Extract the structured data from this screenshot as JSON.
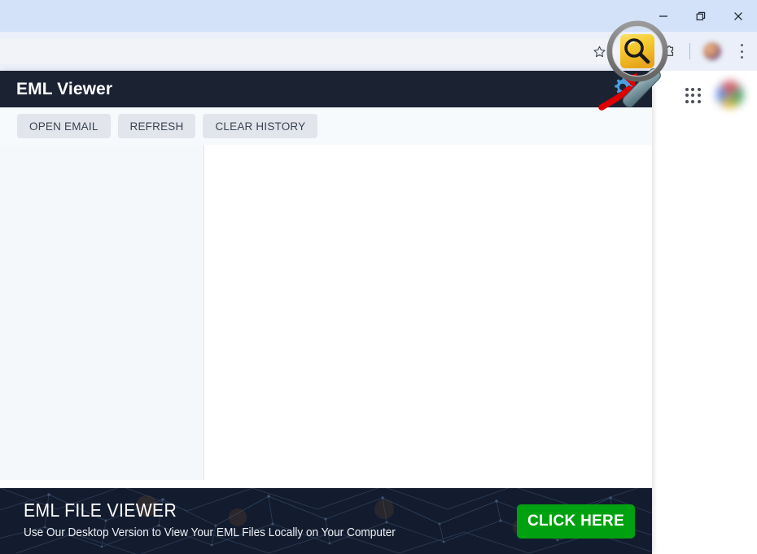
{
  "window": {
    "controls": [
      {
        "name": "minimize",
        "glyph": "minimize-icon"
      },
      {
        "name": "restore",
        "glyph": "restore-icon"
      },
      {
        "name": "close",
        "glyph": "close-icon"
      }
    ]
  },
  "browser_toolbar": {
    "omnibox_value": "",
    "omnibox_placeholder": "",
    "icons": [
      {
        "name": "bookmark-star-icon"
      },
      {
        "name": "magnifier-extension-icon"
      },
      {
        "name": "extensions-puzzle-icon"
      },
      {
        "name": "profile-avatar"
      },
      {
        "name": "chrome-menu-kebab-icon"
      }
    ]
  },
  "page_background": {
    "apps_grid_icon": "google-apps-grid-icon",
    "account_avatar": "google-account-avatar"
  },
  "popup": {
    "header": {
      "title": "EML Viewer",
      "settings_icon": "gear-icon"
    },
    "toolbar": {
      "buttons": [
        {
          "label": "OPEN EMAIL",
          "name": "open-email-button"
        },
        {
          "label": "REFRESH",
          "name": "refresh-button"
        },
        {
          "label": "CLEAR HISTORY",
          "name": "clear-history-button"
        }
      ]
    },
    "sidebar": {
      "items": [],
      "empty": true
    },
    "content": {
      "body": "",
      "empty": true
    },
    "banner": {
      "title": "EML FILE VIEWER",
      "subtitle": "Use Our Desktop Version to View Your EML Files Locally on Your Computer",
      "cta_label": "CLICK HERE"
    }
  },
  "annotations": {
    "magnifier": "magnifier-highlight-overlay",
    "arrow": "red-pointer-arrow"
  },
  "colors": {
    "titlebar": "#d3e2f8",
    "toolbar": "#eaeff9",
    "app_header": "#1b2232",
    "button_bg": "#e2e6ec",
    "sidebar": "#f4f8fb",
    "banner_bg": "#131c2e",
    "cta_green": "#00a110",
    "extension_yellow": "#f3c920",
    "gear_blue": "#4a9fe0",
    "arrow_red": "#e00000"
  }
}
